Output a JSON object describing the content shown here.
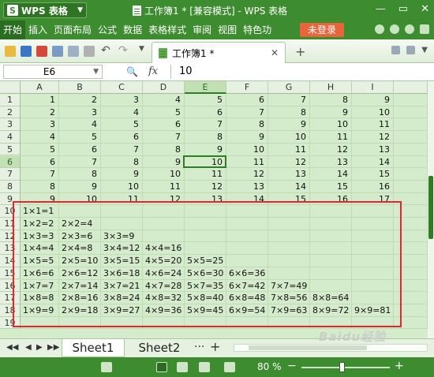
{
  "app": {
    "logo": "S",
    "name": "WPS 表格",
    "title": "工作簿1 * [兼容模式] - WPS 表格"
  },
  "menu": [
    "开始",
    "插入",
    "页面布局",
    "公式",
    "数据",
    "表格样式",
    "审阅",
    "视图",
    "特色功"
  ],
  "login_label": "未登录",
  "doc_tab": {
    "label": "工作簿1 *"
  },
  "formula": {
    "cell_ref": "E6",
    "fx": "fx",
    "value": "10"
  },
  "columns": [
    "A",
    "B",
    "C",
    "D",
    "E",
    "F",
    "G",
    "H",
    "I"
  ],
  "rows": [
    "1",
    "2",
    "3",
    "4",
    "5",
    "6",
    "7",
    "8",
    "9",
    "10",
    "11",
    "12",
    "13",
    "14",
    "15",
    "16",
    "17",
    "18",
    "19"
  ],
  "number_rows": [
    [
      "1",
      "2",
      "3",
      "4",
      "5",
      "6",
      "7",
      "8",
      "9"
    ],
    [
      "2",
      "3",
      "4",
      "5",
      "6",
      "7",
      "8",
      "9",
      "10"
    ],
    [
      "3",
      "4",
      "5",
      "6",
      "7",
      "8",
      "9",
      "10",
      "11"
    ],
    [
      "4",
      "5",
      "6",
      "7",
      "8",
      "9",
      "10",
      "11",
      "12"
    ],
    [
      "5",
      "6",
      "7",
      "8",
      "9",
      "10",
      "11",
      "12",
      "13"
    ],
    [
      "6",
      "7",
      "8",
      "9",
      "10",
      "11",
      "12",
      "13",
      "14"
    ],
    [
      "7",
      "8",
      "9",
      "10",
      "11",
      "12",
      "13",
      "14",
      "15"
    ],
    [
      "8",
      "9",
      "10",
      "11",
      "12",
      "13",
      "14",
      "15",
      "16"
    ],
    [
      "9",
      "10",
      "11",
      "12",
      "13",
      "14",
      "15",
      "16",
      "17"
    ]
  ],
  "multiplication_rows": [
    [
      "1×1=1"
    ],
    [
      "1×2=2",
      "2×2=4"
    ],
    [
      "1×3=3",
      "2×3=6",
      "3×3=9"
    ],
    [
      "1×4=4",
      "2×4=8",
      "3×4=12",
      "4×4=16"
    ],
    [
      "1×5=5",
      "2×5=10",
      "3×5=15",
      "4×5=20",
      "5×5=25"
    ],
    [
      "1×6=6",
      "2×6=12",
      "3×6=18",
      "4×6=24",
      "5×6=30",
      "6×6=36"
    ],
    [
      "1×7=7",
      "2×7=14",
      "3×7=21",
      "4×7=28",
      "5×7=35",
      "6×7=42",
      "7×7=49"
    ],
    [
      "1×8=8",
      "2×8=16",
      "3×8=24",
      "4×8=32",
      "5×8=40",
      "6×8=48",
      "7×8=56",
      "8×8=64"
    ],
    [
      "1×9=9",
      "2×9=18",
      "3×9=27",
      "4×9=36",
      "5×9=45",
      "6×9=54",
      "7×9=63",
      "8×9=72",
      "9×9=81"
    ]
  ],
  "sheet_tabs": [
    "Sheet1",
    "Sheet2"
  ],
  "zoom": {
    "label": "80 %",
    "value": 80
  },
  "watermark": "Baidu经验",
  "colors": {
    "brand": "#3d8c2f",
    "sheet_bg": "#d4eccc",
    "highlight": "#e8252b",
    "login": "#e8643a"
  }
}
